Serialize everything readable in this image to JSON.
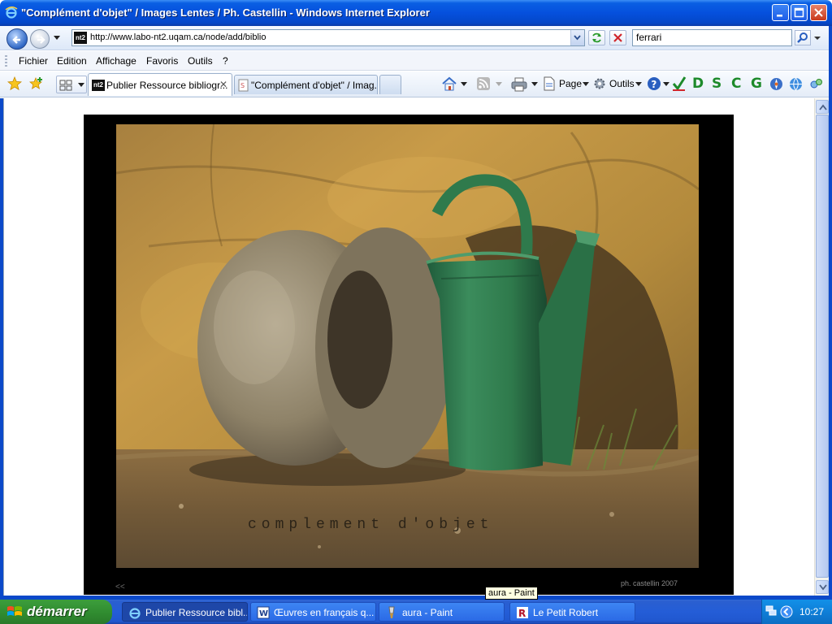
{
  "window": {
    "title": "\"Complément d'objet\" / Images Lentes / Ph. Castellin - Windows Internet Explorer"
  },
  "address": {
    "url": "http://www.labo-nt2.uqam.ca/node/add/biblio",
    "favicon_text": "nt2"
  },
  "search": {
    "value": "ferrari"
  },
  "menu": {
    "items": [
      "Fichier",
      "Edition",
      "Affichage",
      "Favoris",
      "Outils",
      "?"
    ]
  },
  "tabs": [
    {
      "label": "Publier Ressource bibliogr...",
      "favicon": "nt2"
    },
    {
      "label": "\"Complément d'objet\" / Imag..."
    }
  ],
  "commands": {
    "page_label": "Page",
    "tools_label": "Outils",
    "letters": [
      "D",
      "S",
      "C",
      "G"
    ]
  },
  "photo": {
    "caption": "complement d'objet",
    "prev_link": "<<",
    "credit": "ph. castellin 2007"
  },
  "tooltip": {
    "text": "aura - Paint"
  },
  "taskbar": {
    "start_label": "démarrer",
    "tasks": [
      {
        "label": "Publier Ressource bibl..."
      },
      {
        "label": "Œuvres en français q..."
      },
      {
        "label": "aura - Paint"
      },
      {
        "label": "Le Petit Robert"
      }
    ],
    "clock": "10:27"
  },
  "colors": {
    "title_bar": "#0550dd",
    "taskbar": "#245dd7",
    "start_button": "#2f8a2f",
    "watering_can": "#2f7a4c"
  }
}
